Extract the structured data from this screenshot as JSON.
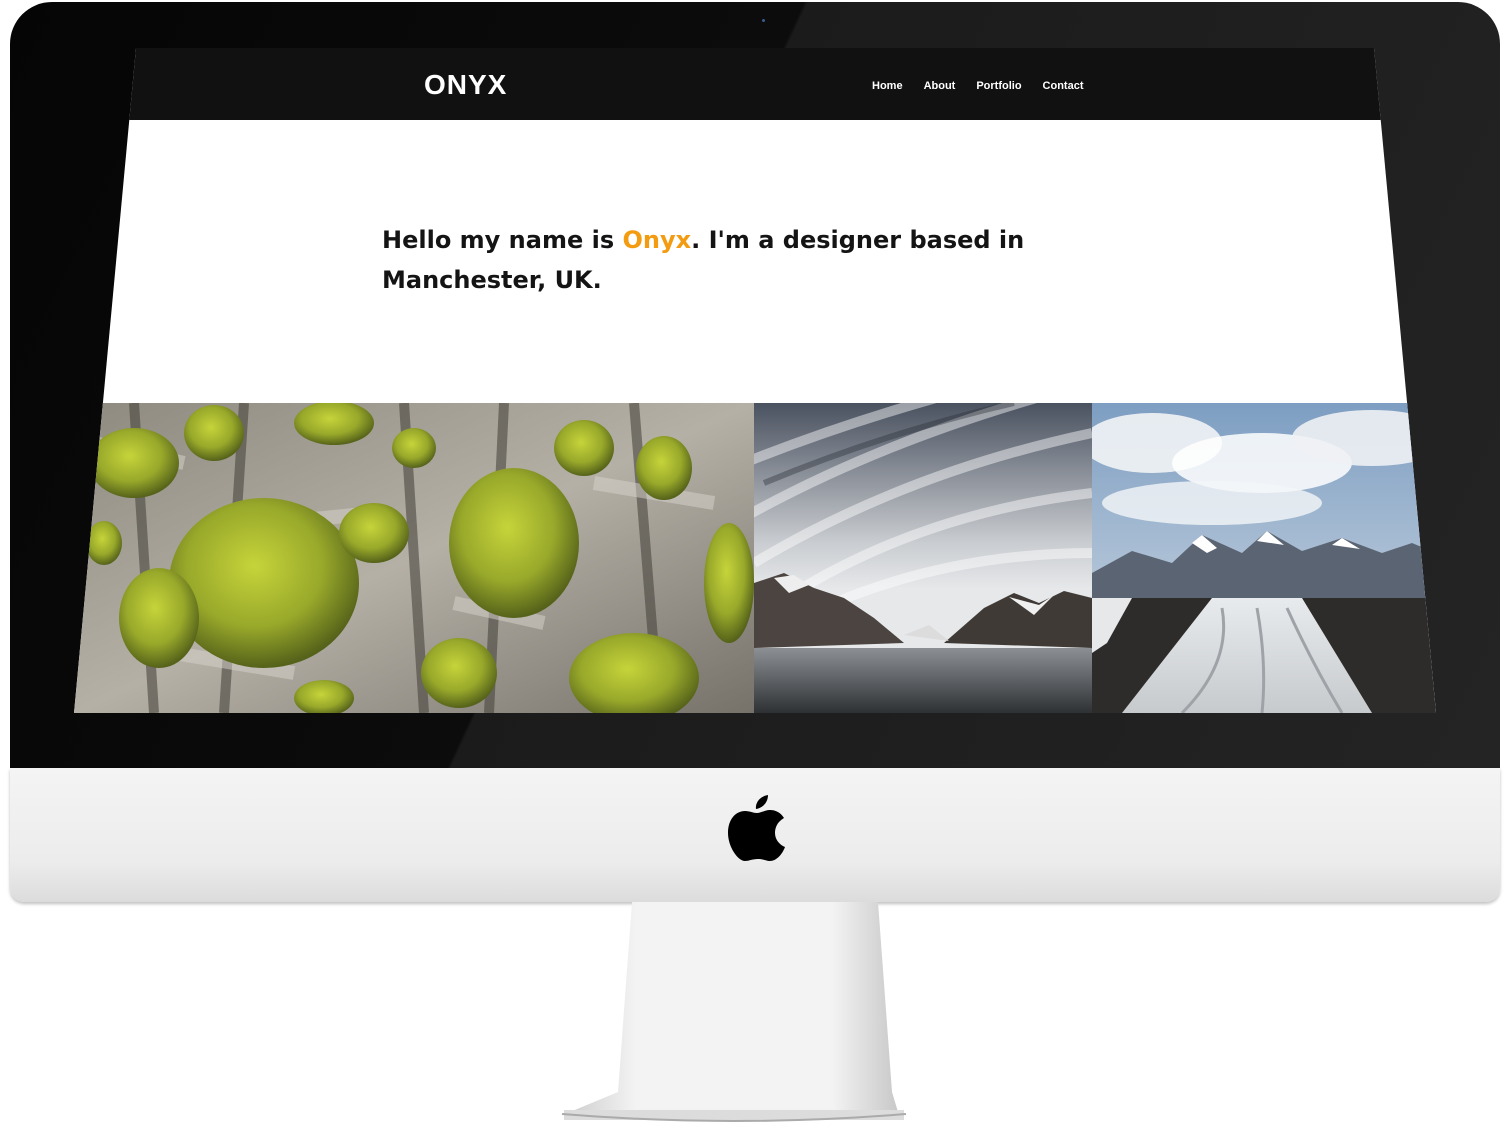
{
  "site": {
    "brand": "ONYX",
    "nav": [
      "Home",
      "About",
      "Portfolio",
      "Contact"
    ]
  },
  "hero": {
    "pre": "Hello my name is ",
    "highlight": "Onyx",
    "post": ". I'm a designer based in Manchester, UK."
  },
  "gallery": {
    "images": [
      "moss-on-bark-photo",
      "mountain-lake-clouds-photo",
      "glacier-valley-photo"
    ]
  },
  "colors": {
    "accent": "#f39c12",
    "navbar": "#111111",
    "text": "#141414",
    "page": "#ffffff"
  },
  "device": {
    "logo": "apple-logo-icon"
  }
}
